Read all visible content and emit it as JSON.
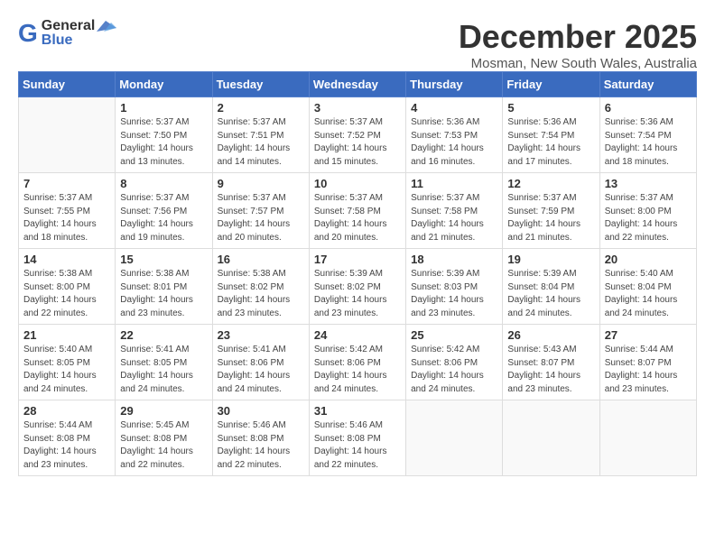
{
  "logo": {
    "line1": "General",
    "line2": "Blue"
  },
  "title": "December 2025",
  "subtitle": "Mosman, New South Wales, Australia",
  "days_of_week": [
    "Sunday",
    "Monday",
    "Tuesday",
    "Wednesday",
    "Thursday",
    "Friday",
    "Saturday"
  ],
  "weeks": [
    [
      {
        "num": "",
        "sunrise": "",
        "sunset": "",
        "daylight": ""
      },
      {
        "num": "1",
        "sunrise": "Sunrise: 5:37 AM",
        "sunset": "Sunset: 7:50 PM",
        "daylight": "Daylight: 14 hours and 13 minutes."
      },
      {
        "num": "2",
        "sunrise": "Sunrise: 5:37 AM",
        "sunset": "Sunset: 7:51 PM",
        "daylight": "Daylight: 14 hours and 14 minutes."
      },
      {
        "num": "3",
        "sunrise": "Sunrise: 5:37 AM",
        "sunset": "Sunset: 7:52 PM",
        "daylight": "Daylight: 14 hours and 15 minutes."
      },
      {
        "num": "4",
        "sunrise": "Sunrise: 5:36 AM",
        "sunset": "Sunset: 7:53 PM",
        "daylight": "Daylight: 14 hours and 16 minutes."
      },
      {
        "num": "5",
        "sunrise": "Sunrise: 5:36 AM",
        "sunset": "Sunset: 7:54 PM",
        "daylight": "Daylight: 14 hours and 17 minutes."
      },
      {
        "num": "6",
        "sunrise": "Sunrise: 5:36 AM",
        "sunset": "Sunset: 7:54 PM",
        "daylight": "Daylight: 14 hours and 18 minutes."
      }
    ],
    [
      {
        "num": "7",
        "sunrise": "Sunrise: 5:37 AM",
        "sunset": "Sunset: 7:55 PM",
        "daylight": "Daylight: 14 hours and 18 minutes."
      },
      {
        "num": "8",
        "sunrise": "Sunrise: 5:37 AM",
        "sunset": "Sunset: 7:56 PM",
        "daylight": "Daylight: 14 hours and 19 minutes."
      },
      {
        "num": "9",
        "sunrise": "Sunrise: 5:37 AM",
        "sunset": "Sunset: 7:57 PM",
        "daylight": "Daylight: 14 hours and 20 minutes."
      },
      {
        "num": "10",
        "sunrise": "Sunrise: 5:37 AM",
        "sunset": "Sunset: 7:58 PM",
        "daylight": "Daylight: 14 hours and 20 minutes."
      },
      {
        "num": "11",
        "sunrise": "Sunrise: 5:37 AM",
        "sunset": "Sunset: 7:58 PM",
        "daylight": "Daylight: 14 hours and 21 minutes."
      },
      {
        "num": "12",
        "sunrise": "Sunrise: 5:37 AM",
        "sunset": "Sunset: 7:59 PM",
        "daylight": "Daylight: 14 hours and 21 minutes."
      },
      {
        "num": "13",
        "sunrise": "Sunrise: 5:37 AM",
        "sunset": "Sunset: 8:00 PM",
        "daylight": "Daylight: 14 hours and 22 minutes."
      }
    ],
    [
      {
        "num": "14",
        "sunrise": "Sunrise: 5:38 AM",
        "sunset": "Sunset: 8:00 PM",
        "daylight": "Daylight: 14 hours and 22 minutes."
      },
      {
        "num": "15",
        "sunrise": "Sunrise: 5:38 AM",
        "sunset": "Sunset: 8:01 PM",
        "daylight": "Daylight: 14 hours and 23 minutes."
      },
      {
        "num": "16",
        "sunrise": "Sunrise: 5:38 AM",
        "sunset": "Sunset: 8:02 PM",
        "daylight": "Daylight: 14 hours and 23 minutes."
      },
      {
        "num": "17",
        "sunrise": "Sunrise: 5:39 AM",
        "sunset": "Sunset: 8:02 PM",
        "daylight": "Daylight: 14 hours and 23 minutes."
      },
      {
        "num": "18",
        "sunrise": "Sunrise: 5:39 AM",
        "sunset": "Sunset: 8:03 PM",
        "daylight": "Daylight: 14 hours and 23 minutes."
      },
      {
        "num": "19",
        "sunrise": "Sunrise: 5:39 AM",
        "sunset": "Sunset: 8:04 PM",
        "daylight": "Daylight: 14 hours and 24 minutes."
      },
      {
        "num": "20",
        "sunrise": "Sunrise: 5:40 AM",
        "sunset": "Sunset: 8:04 PM",
        "daylight": "Daylight: 14 hours and 24 minutes."
      }
    ],
    [
      {
        "num": "21",
        "sunrise": "Sunrise: 5:40 AM",
        "sunset": "Sunset: 8:05 PM",
        "daylight": "Daylight: 14 hours and 24 minutes."
      },
      {
        "num": "22",
        "sunrise": "Sunrise: 5:41 AM",
        "sunset": "Sunset: 8:05 PM",
        "daylight": "Daylight: 14 hours and 24 minutes."
      },
      {
        "num": "23",
        "sunrise": "Sunrise: 5:41 AM",
        "sunset": "Sunset: 8:06 PM",
        "daylight": "Daylight: 14 hours and 24 minutes."
      },
      {
        "num": "24",
        "sunrise": "Sunrise: 5:42 AM",
        "sunset": "Sunset: 8:06 PM",
        "daylight": "Daylight: 14 hours and 24 minutes."
      },
      {
        "num": "25",
        "sunrise": "Sunrise: 5:42 AM",
        "sunset": "Sunset: 8:06 PM",
        "daylight": "Daylight: 14 hours and 24 minutes."
      },
      {
        "num": "26",
        "sunrise": "Sunrise: 5:43 AM",
        "sunset": "Sunset: 8:07 PM",
        "daylight": "Daylight: 14 hours and 23 minutes."
      },
      {
        "num": "27",
        "sunrise": "Sunrise: 5:44 AM",
        "sunset": "Sunset: 8:07 PM",
        "daylight": "Daylight: 14 hours and 23 minutes."
      }
    ],
    [
      {
        "num": "28",
        "sunrise": "Sunrise: 5:44 AM",
        "sunset": "Sunset: 8:08 PM",
        "daylight": "Daylight: 14 hours and 23 minutes."
      },
      {
        "num": "29",
        "sunrise": "Sunrise: 5:45 AM",
        "sunset": "Sunset: 8:08 PM",
        "daylight": "Daylight: 14 hours and 22 minutes."
      },
      {
        "num": "30",
        "sunrise": "Sunrise: 5:46 AM",
        "sunset": "Sunset: 8:08 PM",
        "daylight": "Daylight: 14 hours and 22 minutes."
      },
      {
        "num": "31",
        "sunrise": "Sunrise: 5:46 AM",
        "sunset": "Sunset: 8:08 PM",
        "daylight": "Daylight: 14 hours and 22 minutes."
      },
      {
        "num": "",
        "sunrise": "",
        "sunset": "",
        "daylight": ""
      },
      {
        "num": "",
        "sunrise": "",
        "sunset": "",
        "daylight": ""
      },
      {
        "num": "",
        "sunrise": "",
        "sunset": "",
        "daylight": ""
      }
    ]
  ]
}
